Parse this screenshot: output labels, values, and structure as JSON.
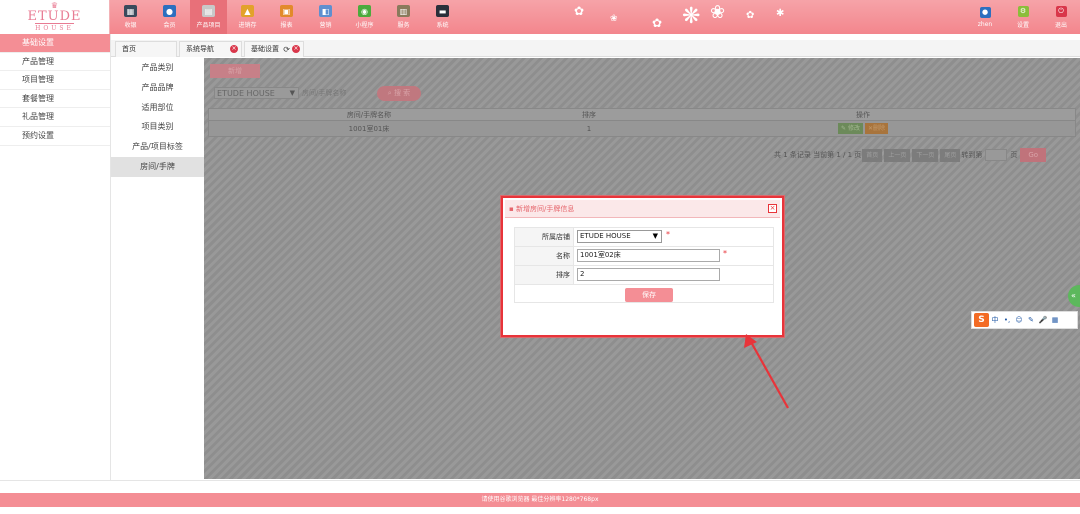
{
  "logo": {
    "crown": "♛",
    "main": "ETUDE",
    "sub": "HOUSE"
  },
  "nav": {
    "items": [
      {
        "label": "收银",
        "icon": "register-icon",
        "color": "#3a4a5c",
        "glyph": "▦"
      },
      {
        "label": "会员",
        "icon": "member-icon",
        "color": "#2c6fbf",
        "glyph": "●"
      },
      {
        "label": "产品项目",
        "icon": "product-icon",
        "color": "#c8c8c8",
        "glyph": "▤"
      },
      {
        "label": "进销存",
        "icon": "inventory-icon",
        "color": "#e2a22b",
        "glyph": "▲"
      },
      {
        "label": "报表",
        "icon": "report-icon",
        "color": "#e28a2b",
        "glyph": "▣"
      },
      {
        "label": "营销",
        "icon": "marketing-icon",
        "color": "#5f8fcf",
        "glyph": "◧"
      },
      {
        "label": "小程序",
        "icon": "wechat-icon",
        "color": "#4caa3d",
        "glyph": "◉"
      },
      {
        "label": "服务",
        "icon": "service-icon",
        "color": "#8a7a5c",
        "glyph": "▥"
      },
      {
        "label": "系统",
        "icon": "system-icon",
        "color": "#2a2f3a",
        "glyph": "▬"
      }
    ],
    "active_index": 2
  },
  "right_nav": [
    {
      "label": "zhen",
      "icon": "user-icon",
      "color": "#2c6fbf",
      "glyph": "●"
    },
    {
      "label": "设置",
      "icon": "settings-icon",
      "color": "#8bbd3a",
      "glyph": "⚙"
    },
    {
      "label": "退出",
      "icon": "logout-icon",
      "color": "#d9364a",
      "glyph": "⏻"
    }
  ],
  "sidebar": {
    "items": [
      "基础设置",
      "产品管理",
      "项目管理",
      "套餐管理",
      "礼品管理",
      "预约设置"
    ],
    "active_index": 0
  },
  "tabs": [
    {
      "label": "首页",
      "close": false,
      "refresh": false
    },
    {
      "label": "系统导航",
      "close": true,
      "refresh": false
    },
    {
      "label": "基础设置",
      "close": true,
      "refresh": true
    }
  ],
  "subsidebar": {
    "items": [
      "产品类别",
      "产品品牌",
      "适用部位",
      "项目类别",
      "产品/项目标签",
      "房间/手牌"
    ],
    "active_index": 5
  },
  "content": {
    "new_button": "新增",
    "store_select": "ETUDE HOUSE",
    "filter_placeholder": "房间/手牌名称",
    "search_button": "搜 索",
    "grid": {
      "headers": [
        "房间/手牌名称",
        "排序",
        "操作"
      ],
      "rows": [
        {
          "name": "1001室01床",
          "order": "1"
        }
      ],
      "edit_label": "修改",
      "delete_label": "删除"
    },
    "pager": {
      "summary": "共 1 条记录 当前第 1 / 1 页",
      "first": "首页",
      "prev": "上一页",
      "next": "下一页",
      "last": "尾页",
      "goto_label": "转到第",
      "page_unit": "页",
      "go": "Go"
    }
  },
  "dialog": {
    "title": "新增房间/手牌信息",
    "fields": [
      {
        "label": "所属店铺",
        "value": "ETUDE HOUSE",
        "type": "select",
        "required": "*"
      },
      {
        "label": "名称",
        "value": "1001室02床",
        "type": "input",
        "required": "*"
      },
      {
        "label": "排序",
        "value": "2",
        "type": "input",
        "required": ""
      }
    ],
    "save_button": "保存"
  },
  "ime": {
    "logo": "S",
    "items": [
      "中",
      "•,",
      "☺",
      "✎",
      "🎤",
      "▦"
    ]
  },
  "footer": "请使用谷歌浏览器 最佳分辨率1280*768px",
  "colors": {
    "brand": "#f48e95",
    "accent_red": "#e8343a",
    "overlay": "#949494"
  }
}
